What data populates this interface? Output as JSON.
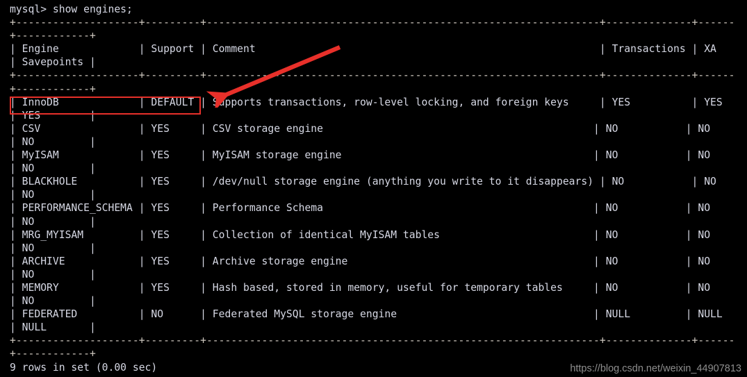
{
  "terminal": {
    "prompt_line": "mysql> show engines;",
    "status_line": "9 rows in set (0.00 sec)",
    "separator_main": "+--------------------+---------+----------------------------------------------------------------+--------------+------",
    "separator_wrap": "+------------+",
    "header_line": "| Engine             | Support | Comment                                                        | Transactions | XA   ",
    "header_wrap": "| Savepoints |",
    "colors": {
      "background": "#000000",
      "text": "#d6d8e4",
      "separator": "#cfc9c0",
      "annotation": "#e8302a",
      "watermark": "#8e8e8e"
    },
    "rows": [
      {
        "main": "| InnoDB             | DEFAULT | Supports transactions, row-level locking, and foreign keys     | YES          | YES  ",
        "wrap": "| YES        |"
      },
      {
        "main": "| CSV                | YES     | CSV storage engine                                            | NO           | NO   ",
        "wrap": "| NO         |"
      },
      {
        "main": "| MyISAM             | YES     | MyISAM storage engine                                         | NO           | NO   ",
        "wrap": "| NO         |"
      },
      {
        "main": "| BLACKHOLE          | YES     | /dev/null storage engine (anything you write to it disappears) | NO           | NO   ",
        "wrap": "| NO         |"
      },
      {
        "main": "| PERFORMANCE_SCHEMA | YES     | Performance Schema                                            | NO           | NO   ",
        "wrap": "| NO         |"
      },
      {
        "main": "| MRG_MYISAM         | YES     | Collection of identical MyISAM tables                         | NO           | NO   ",
        "wrap": "| NO         |"
      },
      {
        "main": "| ARCHIVE            | YES     | Archive storage engine                                        | NO           | NO   ",
        "wrap": "| NO         |"
      },
      {
        "main": "| MEMORY             | YES     | Hash based, stored in memory, useful for temporary tables     | NO           | NO   ",
        "wrap": "| NO         |"
      },
      {
        "main": "| FEDERATED          | NO      | Federated MySQL storage engine                                | NULL         | NULL ",
        "wrap": "| NULL       |"
      }
    ],
    "table": {
      "columns": [
        "Engine",
        "Support",
        "Comment",
        "Transactions",
        "XA",
        "Savepoints"
      ],
      "records": [
        {
          "Engine": "InnoDB",
          "Support": "DEFAULT",
          "Comment": "Supports transactions, row-level locking, and foreign keys",
          "Transactions": "YES",
          "XA": "YES",
          "Savepoints": "YES"
        },
        {
          "Engine": "CSV",
          "Support": "YES",
          "Comment": "CSV storage engine",
          "Transactions": "NO",
          "XA": "NO",
          "Savepoints": "NO"
        },
        {
          "Engine": "MyISAM",
          "Support": "YES",
          "Comment": "MyISAM storage engine",
          "Transactions": "NO",
          "XA": "NO",
          "Savepoints": "NO"
        },
        {
          "Engine": "BLACKHOLE",
          "Support": "YES",
          "Comment": "/dev/null storage engine (anything you write to it disappears)",
          "Transactions": "NO",
          "XA": "NO",
          "Savepoints": "NO"
        },
        {
          "Engine": "PERFORMANCE_SCHEMA",
          "Support": "YES",
          "Comment": "Performance Schema",
          "Transactions": "NO",
          "XA": "NO",
          "Savepoints": "NO"
        },
        {
          "Engine": "MRG_MYISAM",
          "Support": "YES",
          "Comment": "Collection of identical MyISAM tables",
          "Transactions": "NO",
          "XA": "NO",
          "Savepoints": "NO"
        },
        {
          "Engine": "ARCHIVE",
          "Support": "YES",
          "Comment": "Archive storage engine",
          "Transactions": "NO",
          "XA": "NO",
          "Savepoints": "NO"
        },
        {
          "Engine": "MEMORY",
          "Support": "YES",
          "Comment": "Hash based, stored in memory, useful for temporary tables",
          "Transactions": "NO",
          "XA": "NO",
          "Savepoints": "NO"
        },
        {
          "Engine": "FEDERATED",
          "Support": "NO",
          "Comment": "Federated MySQL storage engine",
          "Transactions": "NULL",
          "XA": "NULL",
          "Savepoints": "NULL"
        }
      ]
    }
  },
  "annotations": {
    "highlight_target": "InnoDB | DEFAULT |",
    "arrow_points_to": "InnoDB row"
  },
  "watermark": {
    "text": "https://blog.csdn.net/weixin_44907813"
  }
}
